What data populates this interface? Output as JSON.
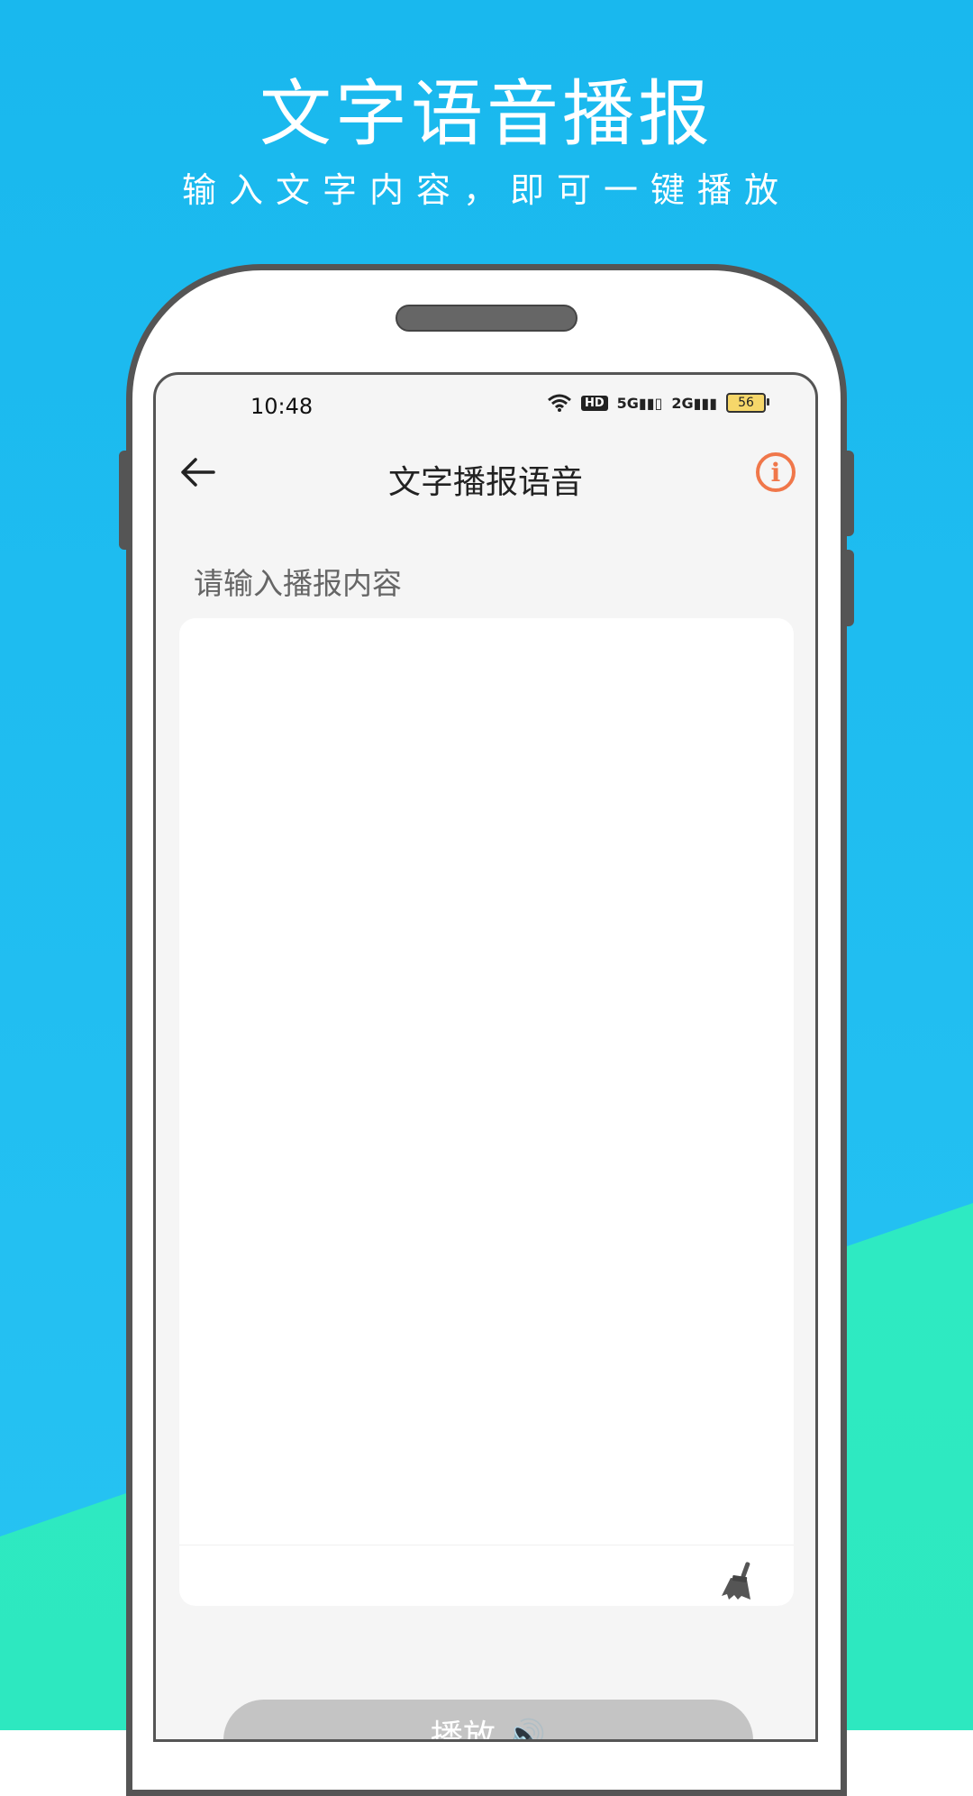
{
  "promo": {
    "title": "文字语音播报",
    "subtitle": "输入文字内容，即可一键播放"
  },
  "status_bar": {
    "time": "10:48",
    "network_1": "5G",
    "network_2": "2G",
    "hd_label": "HD",
    "battery": "56"
  },
  "nav": {
    "title": "文字播报语音",
    "back_icon": "arrow-left-icon",
    "info_icon": "info-circle-icon",
    "info_glyph": "i"
  },
  "content": {
    "input_label": "请输入播报内容",
    "input_value": "",
    "clear_icon": "broom-icon"
  },
  "actions": {
    "play_label": "播放 🔊"
  },
  "colors": {
    "sky": "#19b8ee",
    "mint": "#31f0c6",
    "accent": "#f0774a",
    "button_disabled": "#c4c4c4"
  }
}
